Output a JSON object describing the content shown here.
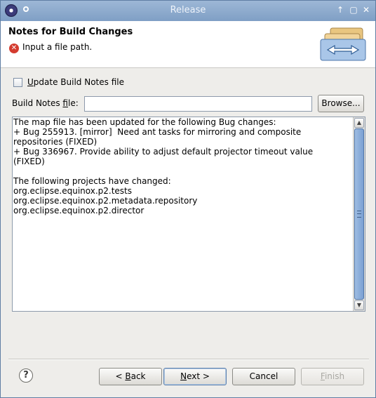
{
  "window": {
    "title": "Release"
  },
  "header": {
    "title": "Notes for Build Changes",
    "error_message": "Input a file path."
  },
  "update_checkbox": {
    "label_prefix": "U",
    "label_rest": "pdate Build Notes file",
    "checked": false
  },
  "file_field": {
    "label_prefix": "Build Notes ",
    "label_mnemonic": "f",
    "label_suffix": "ile:",
    "value": "",
    "placeholder": ""
  },
  "browse_button": {
    "label": "Browse..."
  },
  "notes_text": "The map file has been updated for the following Bug changes:\n+ Bug 255913. [mirror]  Need ant tasks for mirroring and composite\nrepositories (FIXED)\n+ Bug 336967. Provide ability to adjust default projector timeout value\n(FIXED)\n\nThe following projects have changed:\norg.eclipse.equinox.p2.tests\norg.eclipse.equinox.p2.metadata.repository\norg.eclipse.equinox.p2.director",
  "buttons": {
    "back_prefix": "< ",
    "back_mnemonic": "B",
    "back_rest": "ack",
    "next_mnemonic": "N",
    "next_rest": "ext >",
    "cancel": "Cancel",
    "finish_mnemonic": "F",
    "finish_rest": "inish"
  },
  "icons": {
    "app": "eclipse-icon",
    "menu": "window-menu-icon",
    "maximize_up": "up-arrow-icon",
    "maximize": "maximize-icon",
    "close": "close-icon",
    "error": "error-icon",
    "banner": "folders-sync-icon",
    "help": "help-icon"
  },
  "colors": {
    "titlebar": "#8ea9cd",
    "error": "#d43b2f",
    "scroll_thumb": "#7aa0d3"
  }
}
